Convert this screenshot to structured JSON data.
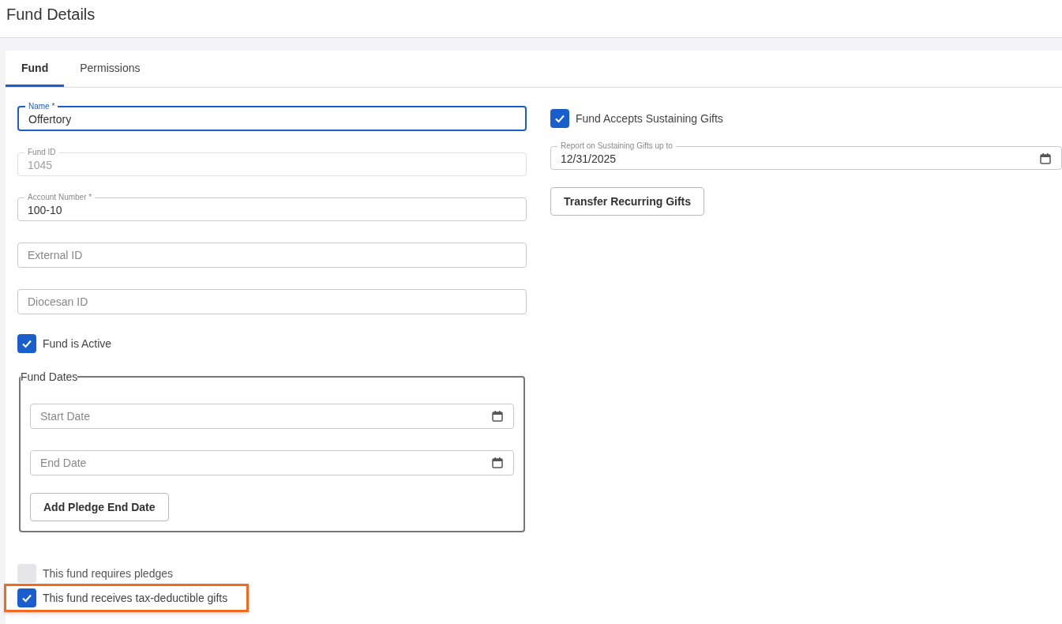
{
  "header": {
    "title": "Fund Details"
  },
  "tabs": [
    {
      "label": "Fund",
      "selected": true
    },
    {
      "label": "Permissions",
      "selected": false
    }
  ],
  "left": {
    "fields": [
      {
        "kind": "text",
        "label": "Name *",
        "value": "Offertory",
        "focused": true,
        "disabled": false
      },
      {
        "kind": "text",
        "label": "Fund ID",
        "value": "1045",
        "focused": false,
        "disabled": true
      },
      {
        "kind": "text",
        "label": "Account Number *",
        "value": "100-10",
        "focused": false,
        "disabled": false
      },
      {
        "kind": "text",
        "placeholder": "External ID",
        "focused": false
      },
      {
        "kind": "text",
        "placeholder": "Diocesan ID",
        "focused": false
      }
    ],
    "active_checkbox": {
      "label": "Fund is Active",
      "checked": true,
      "highlighted": false
    },
    "fund_dates": {
      "legend": "Fund Dates",
      "fields": [
        {
          "kind": "date",
          "placeholder": "Start Date",
          "focused": false
        },
        {
          "kind": "date",
          "placeholder": "End Date",
          "focused": false
        }
      ],
      "button": "Add Pledge End Date"
    },
    "bottom_checkboxes": [
      {
        "label": "This fund requires pledges",
        "checked": false,
        "disabled": true,
        "highlighted": false
      },
      {
        "label": "This fund receives tax-deductible gifts",
        "checked": true,
        "highlighted": true
      }
    ]
  },
  "right": {
    "checkbox": {
      "label": "Fund Accepts Sustaining Gifts",
      "checked": true,
      "highlighted": false
    },
    "fields": [
      {
        "kind": "date",
        "label": "Report on Sustaining Gifts up to",
        "value": "12/31/2025",
        "focused": false
      }
    ],
    "button": "Transfer Recurring Gifts"
  }
}
